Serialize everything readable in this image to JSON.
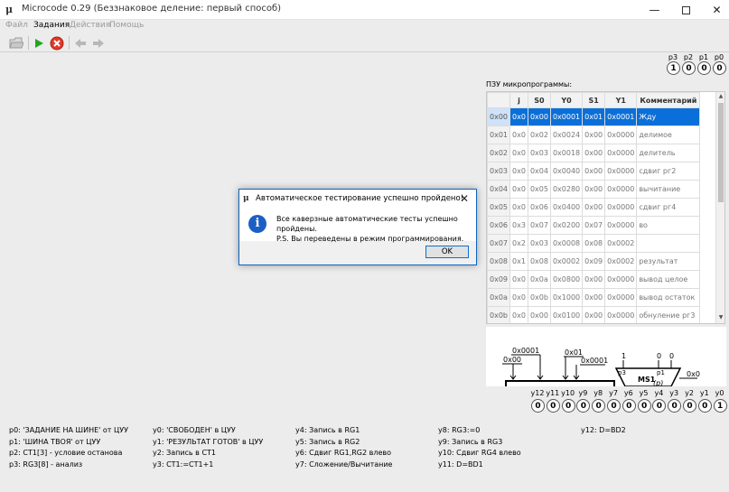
{
  "window": {
    "title": "Microcode 0.29 (Беззнаковое деление: первый способ)",
    "app_icon": "microcode-logo-icon",
    "minimize_glyph": "—",
    "close_glyph": "✕"
  },
  "menu": [
    {
      "label": "Файл",
      "enabled": false
    },
    {
      "label": "Задания",
      "enabled": true
    },
    {
      "label": "Действия",
      "enabled": false
    },
    {
      "label": "Помощь",
      "enabled": false
    }
  ],
  "toolbar": {
    "icons": [
      "open-folder-icon",
      "run-icon",
      "stop-icon",
      "back-icon",
      "forward-icon"
    ]
  },
  "flags": {
    "labels": [
      "p3",
      "p2",
      "p1",
      "p0"
    ],
    "values": [
      "1",
      "0",
      "0",
      "0"
    ]
  },
  "rom": {
    "label": "ПЗУ микропрограммы:",
    "columns": [
      "j",
      "S0",
      "Y0",
      "S1",
      "Y1",
      "Комментарий"
    ],
    "rows": [
      {
        "addr": "0x00",
        "cells": [
          "0x0",
          "0x00",
          "0x0001",
          "0x01",
          "0x0001",
          "Жду"
        ],
        "selected": true
      },
      {
        "addr": "0x01",
        "cells": [
          "0x0",
          "0x02",
          "0x0024",
          "0x00",
          "0x0000",
          "делимое"
        ]
      },
      {
        "addr": "0x02",
        "cells": [
          "0x0",
          "0x03",
          "0x0018",
          "0x00",
          "0x0000",
          "делитель"
        ]
      },
      {
        "addr": "0x03",
        "cells": [
          "0x0",
          "0x04",
          "0x0040",
          "0x00",
          "0x0000",
          "сдвиг рг2"
        ]
      },
      {
        "addr": "0x04",
        "cells": [
          "0x0",
          "0x05",
          "0x0280",
          "0x00",
          "0x0000",
          "вычитание"
        ]
      },
      {
        "addr": "0x05",
        "cells": [
          "0x0",
          "0x06",
          "0x0400",
          "0x00",
          "0x0000",
          "сдвиг рг4"
        ]
      },
      {
        "addr": "0x06",
        "cells": [
          "0x3",
          "0x07",
          "0x0200",
          "0x07",
          "0x0000",
          "во"
        ]
      },
      {
        "addr": "0x07",
        "cells": [
          "0x2",
          "0x03",
          "0x0008",
          "0x08",
          "0x0002",
          ""
        ]
      },
      {
        "addr": "0x08",
        "cells": [
          "0x1",
          "0x08",
          "0x0002",
          "0x09",
          "0x0002",
          "результат"
        ]
      },
      {
        "addr": "0x09",
        "cells": [
          "0x0",
          "0x0a",
          "0x0800",
          "0x00",
          "0x0000",
          "вывод целое"
        ]
      },
      {
        "addr": "0x0a",
        "cells": [
          "0x0",
          "0x0b",
          "0x1000",
          "0x00",
          "0x0000",
          "вывод остаток"
        ]
      },
      {
        "addr": "0x0b",
        "cells": [
          "0x0",
          "0x00",
          "0x0100",
          "0x00",
          "0x0000",
          "обнуление рг3"
        ]
      }
    ]
  },
  "diagram": {
    "labels": [
      "0x0001",
      "0x00",
      "0x01",
      "0x0001",
      "1",
      "0",
      "0",
      "p3",
      "p1",
      "MS1",
      "(p)",
      "0x0"
    ]
  },
  "ybits": {
    "labels": [
      "y12",
      "y11",
      "y10",
      "y9",
      "y8",
      "y7",
      "y6",
      "y5",
      "y4",
      "y3",
      "y2",
      "y1",
      "y0"
    ],
    "values": [
      "0",
      "0",
      "0",
      "0",
      "0",
      "0",
      "0",
      "0",
      "0",
      "0",
      "0",
      "0",
      "1"
    ]
  },
  "legend": {
    "col1": [
      "p0: 'ЗАДАНИЕ НА ШИНЕ' от ЦУУ",
      "p1: 'ШИНА ТВОЯ' от ЦУУ",
      "p2: CT1[3] - условие останова",
      "p3: RG3[8] - анализ"
    ],
    "col2": [
      "y0: 'СВОБОДЕН' в ЦУУ",
      "y1: 'РЕЗУЛЬТАТ ГОТОВ' в ЦУУ",
      "y2: Запись в CT1",
      "y3: CT1:=CT1+1"
    ],
    "col3": [
      "y4: Запись в RG1",
      "y5: Запись в RG2",
      "y6: Сдвиг RG1,RG2 влево",
      "y7: Сложение/Вычитание"
    ],
    "col4": [
      "y8: RG3:=0",
      "y9: Запись в RG3",
      "y10: Сдвиг RG4 влево",
      "y11: D=BD1"
    ],
    "col5": [
      "y12: D=BD2"
    ]
  },
  "dialog": {
    "title": "Автоматическое тестирование успешно пройдено!",
    "line1": "Все каверзные автоматические тесты успешно пройдены.",
    "line2": "P.S. Вы переведены в режим программирования.",
    "ok_label": "OK",
    "close_glyph": "✕",
    "icon_glyph": "i"
  }
}
